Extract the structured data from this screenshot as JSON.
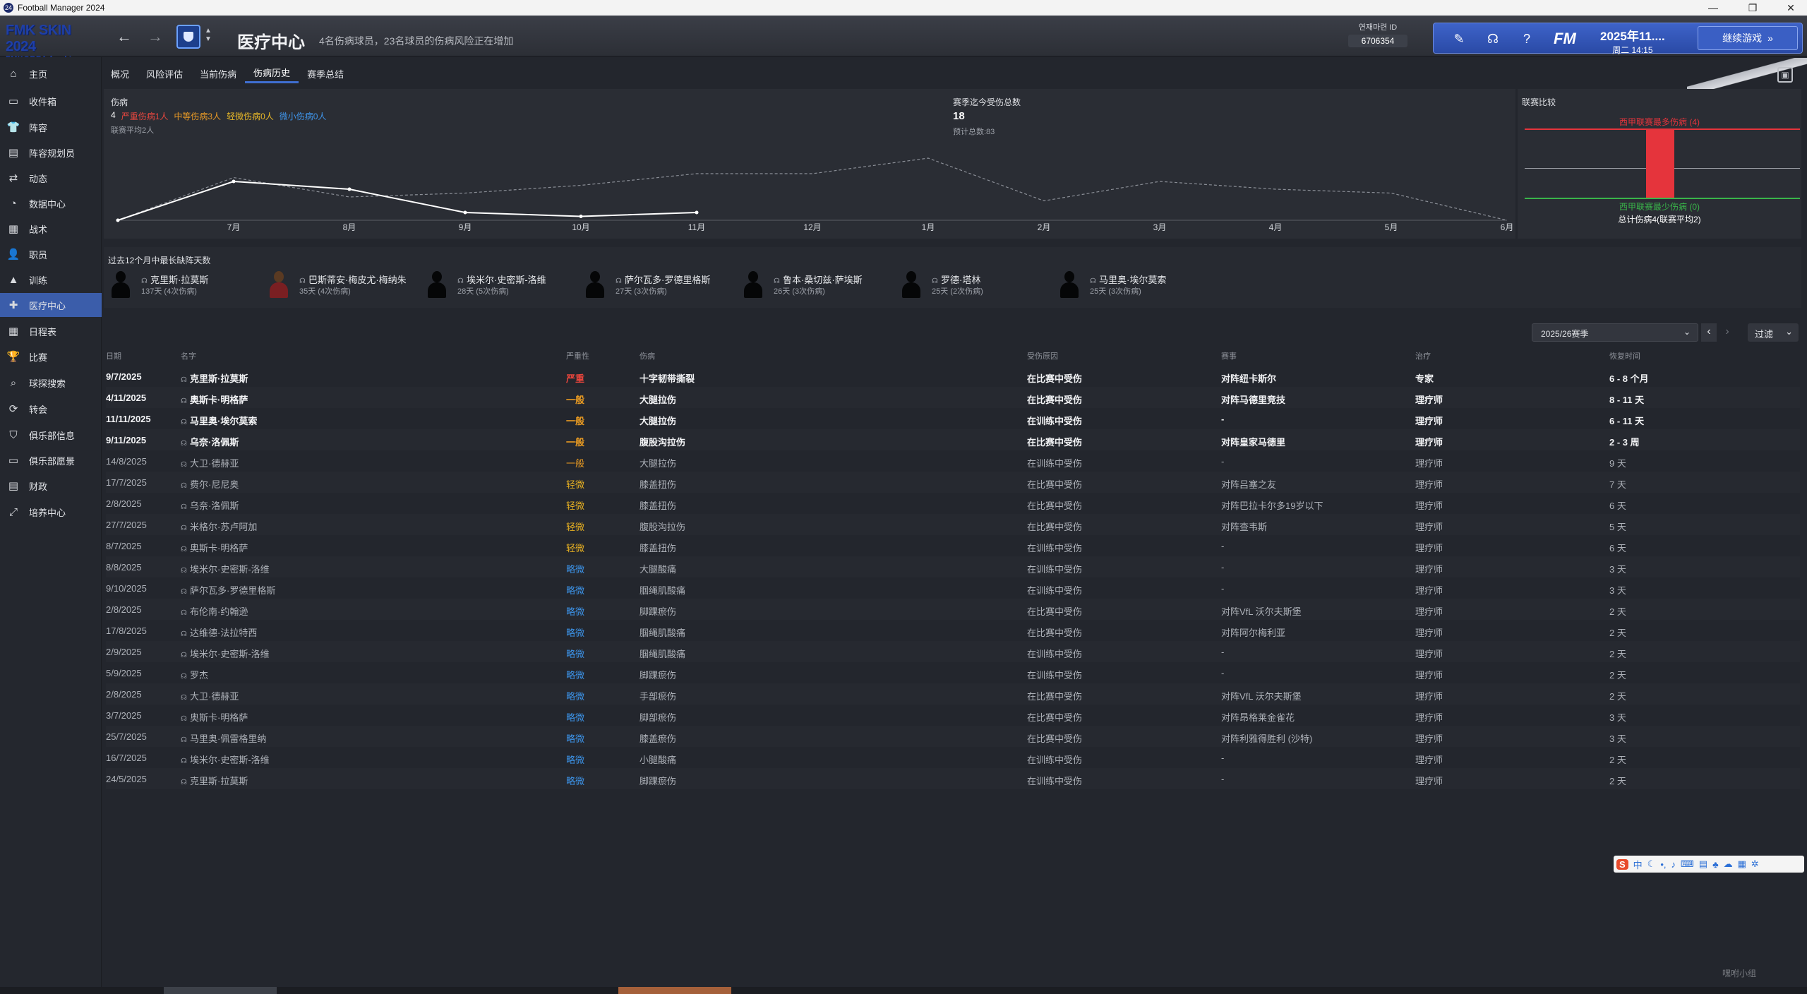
{
  "window": {
    "title": "Football Manager 2024",
    "app_icon": "fm-app-icon",
    "minimize": "—",
    "restore": "❐",
    "close": "✕"
  },
  "header": {
    "skin_line1": "FMK SKIN 2024",
    "skin_line2": "FMKOREA fmskins",
    "page_title": "医疗中心",
    "subtitle": "4名伤病球员，23名球员的伤病风险正在增加",
    "id_label": "연재마련 ID",
    "id_value": "6706354",
    "fm_logo": "FM",
    "date_line1": "2025年11....",
    "date_line2": "周二 14:15",
    "continue_label": "继续游戏"
  },
  "sidebar": {
    "items": [
      {
        "label": "主页",
        "icon": "home-icon",
        "glyph": "⌂"
      },
      {
        "label": "收件箱",
        "icon": "inbox-icon",
        "glyph": "▭"
      },
      {
        "label": "阵容",
        "icon": "squad-icon",
        "glyph": "👕"
      },
      {
        "label": "阵容规划员",
        "icon": "squad-planner-icon",
        "glyph": "▤"
      },
      {
        "label": "动态",
        "icon": "dynamics-icon",
        "glyph": "⇄"
      },
      {
        "label": "数据中心",
        "icon": "data-hub-icon",
        "glyph": "◔"
      },
      {
        "label": "战术",
        "icon": "tactics-icon",
        "glyph": "▦"
      },
      {
        "label": "职员",
        "icon": "staff-icon",
        "glyph": "👤"
      },
      {
        "label": "训练",
        "icon": "training-icon",
        "glyph": "▲"
      },
      {
        "label": "医疗中心",
        "icon": "medical-icon",
        "glyph": "✚"
      },
      {
        "label": "日程表",
        "icon": "schedule-icon",
        "glyph": "▦"
      },
      {
        "label": "比赛",
        "icon": "competitions-icon",
        "glyph": "🏆"
      },
      {
        "label": "球探搜索",
        "icon": "scouting-icon",
        "glyph": "⌕"
      },
      {
        "label": "转会",
        "icon": "transfers-icon",
        "glyph": "⟳"
      },
      {
        "label": "俱乐部信息",
        "icon": "club-info-icon",
        "glyph": "⛉"
      },
      {
        "label": "俱乐部愿景",
        "icon": "club-vision-icon",
        "glyph": "▭"
      },
      {
        "label": "财政",
        "icon": "finances-icon",
        "glyph": "▤"
      },
      {
        "label": "培养中心",
        "icon": "development-icon",
        "glyph": "⤢"
      }
    ],
    "active_index": 9
  },
  "tabs": [
    "概况",
    "风险评估",
    "当前伤病",
    "伤病历史",
    "赛季总结"
  ],
  "active_tab": 3,
  "injury_summary": {
    "title": "伤病",
    "count": "4",
    "severe": "严重伤病1人",
    "moderate": "中等伤病3人",
    "light": "轻微伤病0人",
    "minor": "微小伤病0人",
    "league_avg": "联赛平均2人",
    "season_title": "赛季迄今受伤总数",
    "season_count": "18",
    "season_projected": "预计总数:83"
  },
  "chart_data": {
    "type": "line",
    "categories": [
      "6月",
      "7月",
      "8月",
      "9月",
      "10月",
      "11月",
      "12月",
      "1月",
      "2月",
      "3月",
      "4月",
      "5月",
      "6月"
    ],
    "category_labels": [
      "7月",
      "8月",
      "9月",
      "10月",
      "11月",
      "12月",
      "1月",
      "2月",
      "3月",
      "4月",
      "5月",
      "6月"
    ],
    "series": [
      {
        "style": "solid",
        "color": "#ffffff",
        "values": [
          0,
          5,
          4,
          1,
          0.5,
          1
        ]
      },
      {
        "style": "dashed",
        "color": "#8a8e96",
        "values": [
          0,
          5.5,
          3,
          3.5,
          4.5,
          6,
          6,
          8,
          2.5,
          5,
          4,
          3.5,
          0
        ]
      }
    ],
    "ylim": [
      0,
      10
    ],
    "grid": false,
    "legend": "none"
  },
  "league_compare": {
    "title": "联赛比较",
    "most_label": "西甲联赛最多伤病 (4)",
    "least_label": "西甲联赛最少伤病 (0)",
    "total_label": "总计伤病4(联赛平均2)",
    "value": 4,
    "max": 4,
    "avg": 2,
    "min": 0,
    "bar_color": "#e5343c",
    "most_color": "#e5343c",
    "least_color": "#39b54a"
  },
  "longest": {
    "title": "过去12个月中最长缺阵天数",
    "players": [
      {
        "name": "克里斯·拉莫斯",
        "detail": "137天 (4次伤病)",
        "photo": false
      },
      {
        "name": "巴斯蒂安·梅皮尤·梅纳朱",
        "detail": "35天 (4次伤病)",
        "photo": true
      },
      {
        "name": "埃米尔·史密斯-洛维",
        "detail": "28天 (5次伤病)",
        "photo": false
      },
      {
        "name": "萨尔瓦多·罗德里格斯",
        "detail": "27天 (3次伤病)",
        "photo": false
      },
      {
        "name": "鲁本·桑切兹·萨埃斯",
        "detail": "26天 (3次伤病)",
        "photo": false
      },
      {
        "name": "罗德·塔林",
        "detail": "25天 (2次伤病)",
        "photo": false
      },
      {
        "name": "马里奥·埃尔莫索",
        "detail": "25天 (3次伤病)",
        "photo": false
      }
    ]
  },
  "filters": {
    "season": "2025/26赛季",
    "prev": "‹",
    "next": "›",
    "filter_label": "过滤"
  },
  "table": {
    "headers": [
      "日期",
      "名字",
      "严重性",
      "伤病",
      "受伤原因",
      "赛事",
      "治疗",
      "恢复时间"
    ],
    "rows": [
      {
        "date": "9/7/2025",
        "name": "克里斯·拉莫斯",
        "severity": "严重",
        "injury": "十字韧带撕裂",
        "cause": "在比赛中受伤",
        "match": "对阵纽卡斯尔",
        "treatment": "专家",
        "recovery": "6 - 8 个月",
        "current": true
      },
      {
        "date": "4/11/2025",
        "name": "奥斯卡·明格萨",
        "severity": "一般",
        "injury": "大腿拉伤",
        "cause": "在比赛中受伤",
        "match": "对阵马德里竞技",
        "treatment": "理疗师",
        "recovery": "8 - 11 天",
        "current": true
      },
      {
        "date": "11/11/2025",
        "name": "马里奥·埃尔莫索",
        "severity": "一般",
        "injury": "大腿拉伤",
        "cause": "在训练中受伤",
        "match": "-",
        "treatment": "理疗师",
        "recovery": "6 - 11 天",
        "current": true
      },
      {
        "date": "9/11/2025",
        "name": "乌奈·洛佩斯",
        "severity": "一般",
        "injury": "腹股沟拉伤",
        "cause": "在比赛中受伤",
        "match": "对阵皇家马德里",
        "treatment": "理疗师",
        "recovery": "2 - 3 周",
        "current": true
      },
      {
        "date": "14/8/2025",
        "name": "大卫·德赫亚",
        "severity": "一般",
        "injury": "大腿拉伤",
        "cause": "在训练中受伤",
        "match": "-",
        "treatment": "理疗师",
        "recovery": "9 天",
        "current": false
      },
      {
        "date": "17/7/2025",
        "name": "费尔·尼尼奥",
        "severity": "轻微",
        "injury": "膝盖扭伤",
        "cause": "在比赛中受伤",
        "match": "对阵吕塞之友",
        "treatment": "理疗师",
        "recovery": "7 天",
        "current": false
      },
      {
        "date": "2/8/2025",
        "name": "乌奈·洛佩斯",
        "severity": "轻微",
        "injury": "膝盖扭伤",
        "cause": "在比赛中受伤",
        "match": "对阵巴拉卡尔多19岁以下",
        "treatment": "理疗师",
        "recovery": "6 天",
        "current": false
      },
      {
        "date": "27/7/2025",
        "name": "米格尔·苏卢阿加",
        "severity": "轻微",
        "injury": "腹股沟拉伤",
        "cause": "在比赛中受伤",
        "match": "对阵查韦斯",
        "treatment": "理疗师",
        "recovery": "5 天",
        "current": false
      },
      {
        "date": "8/7/2025",
        "name": "奥斯卡·明格萨",
        "severity": "轻微",
        "injury": "膝盖扭伤",
        "cause": "在训练中受伤",
        "match": "-",
        "treatment": "理疗师",
        "recovery": "6 天",
        "current": false
      },
      {
        "date": "8/8/2025",
        "name": "埃米尔·史密斯-洛维",
        "severity": "略微",
        "injury": "大腿酸痛",
        "cause": "在训练中受伤",
        "match": "-",
        "treatment": "理疗师",
        "recovery": "3 天",
        "current": false
      },
      {
        "date": "9/10/2025",
        "name": "萨尔瓦多·罗德里格斯",
        "severity": "略微",
        "injury": "腘绳肌酸痛",
        "cause": "在训练中受伤",
        "match": "-",
        "treatment": "理疗师",
        "recovery": "3 天",
        "current": false
      },
      {
        "date": "2/8/2025",
        "name": "布伦南·约翰逊",
        "severity": "略微",
        "injury": "脚踝瘀伤",
        "cause": "在比赛中受伤",
        "match": "对阵VfL 沃尔夫斯堡",
        "treatment": "理疗师",
        "recovery": "2 天",
        "current": false
      },
      {
        "date": "17/8/2025",
        "name": "达维德·法拉特西",
        "severity": "略微",
        "injury": "腘绳肌酸痛",
        "cause": "在比赛中受伤",
        "match": "对阵阿尔梅利亚",
        "treatment": "理疗师",
        "recovery": "2 天",
        "current": false
      },
      {
        "date": "2/9/2025",
        "name": "埃米尔·史密斯-洛维",
        "severity": "略微",
        "injury": "腘绳肌酸痛",
        "cause": "在训练中受伤",
        "match": "-",
        "treatment": "理疗师",
        "recovery": "2 天",
        "current": false
      },
      {
        "date": "5/9/2025",
        "name": "罗杰",
        "severity": "略微",
        "injury": "脚踝瘀伤",
        "cause": "在训练中受伤",
        "match": "-",
        "treatment": "理疗师",
        "recovery": "2 天",
        "current": false
      },
      {
        "date": "2/8/2025",
        "name": "大卫·德赫亚",
        "severity": "略微",
        "injury": "手部瘀伤",
        "cause": "在比赛中受伤",
        "match": "对阵VfL 沃尔夫斯堡",
        "treatment": "理疗师",
        "recovery": "2 天",
        "current": false
      },
      {
        "date": "3/7/2025",
        "name": "奥斯卡·明格萨",
        "severity": "略微",
        "injury": "脚部瘀伤",
        "cause": "在比赛中受伤",
        "match": "对阵昂格莱金雀花",
        "treatment": "理疗师",
        "recovery": "3 天",
        "current": false
      },
      {
        "date": "25/7/2025",
        "name": "马里奥·佩雷格里纳",
        "severity": "略微",
        "injury": "膝盖瘀伤",
        "cause": "在比赛中受伤",
        "match": "对阵利雅得胜利 (沙特)",
        "treatment": "理疗师",
        "recovery": "3 天",
        "current": false
      },
      {
        "date": "16/7/2025",
        "name": "埃米尔·史密斯-洛维",
        "severity": "略微",
        "injury": "小腿酸痛",
        "cause": "在训练中受伤",
        "match": "-",
        "treatment": "理疗师",
        "recovery": "2 天",
        "current": false
      },
      {
        "date": "24/5/2025",
        "name": "克里斯·拉莫斯",
        "severity": "略微",
        "injury": "脚踝瘀伤",
        "cause": "在训练中受伤",
        "match": "-",
        "treatment": "理疗师",
        "recovery": "2 天",
        "current": false
      }
    ]
  },
  "watermark": "嘿咐小组"
}
